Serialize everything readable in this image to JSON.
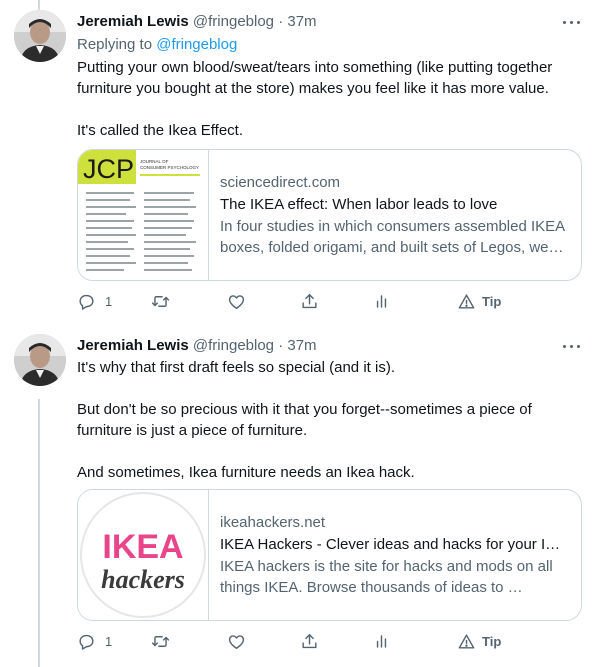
{
  "colors": {
    "accent": "#1d9bf0",
    "secondary_text": "#536471",
    "border": "#cfd9de"
  },
  "tweets": [
    {
      "author_name": "Jeremiah Lewis",
      "author_handle": "@fringeblog",
      "separator": "·",
      "time": "37m",
      "replying_prefix": "Replying to ",
      "replying_handle": "@fringeblog",
      "text": [
        "Putting your own blood/sweat/tears into something (like putting together furniture you bought at the store) makes you feel like it has more value.",
        "It's called the Ikea Effect."
      ],
      "card": {
        "thumb_logo": "JCP",
        "thumb_subtitle_1": "JOURNAL OF",
        "thumb_subtitle_2": "CONSUMER PSYCHOLOGY",
        "domain": "sciencedirect.com",
        "title": "The IKEA effect: When labor leads to love",
        "description": "In four studies in which consumers assembled IKEA boxes, folded origami, and built sets of Legos, we demonstrate and investigate boundary conditions…"
      },
      "actions": {
        "reply_count": "1",
        "tip_label": "Tip"
      },
      "icons": [
        "reply-icon",
        "retweet-icon",
        "like-icon",
        "share-icon",
        "analytics-icon",
        "tip-icon",
        "more-icon"
      ]
    },
    {
      "author_name": "Jeremiah Lewis",
      "author_handle": "@fringeblog",
      "separator": "·",
      "time": "37m",
      "text": [
        "It's why that first draft feels so special (and it is).",
        "But don't be so precious with it that you forget--sometimes a piece of furniture is just a piece of furniture.",
        "And sometimes, Ikea furniture needs an Ikea hack."
      ],
      "card": {
        "thumb_logo_top": "IKEA",
        "thumb_logo_bottom": "hackers",
        "domain": "ikeahackers.net",
        "title": "IKEA Hackers - Clever ideas and hacks for your IKEA",
        "description": "IKEA hackers is the site for hacks and mods on all things IKEA. Browse thousands of ideas to …"
      },
      "actions": {
        "reply_count": "1",
        "tip_label": "Tip"
      },
      "icons": [
        "reply-icon",
        "retweet-icon",
        "like-icon",
        "share-icon",
        "analytics-icon",
        "tip-icon",
        "more-icon"
      ]
    }
  ]
}
